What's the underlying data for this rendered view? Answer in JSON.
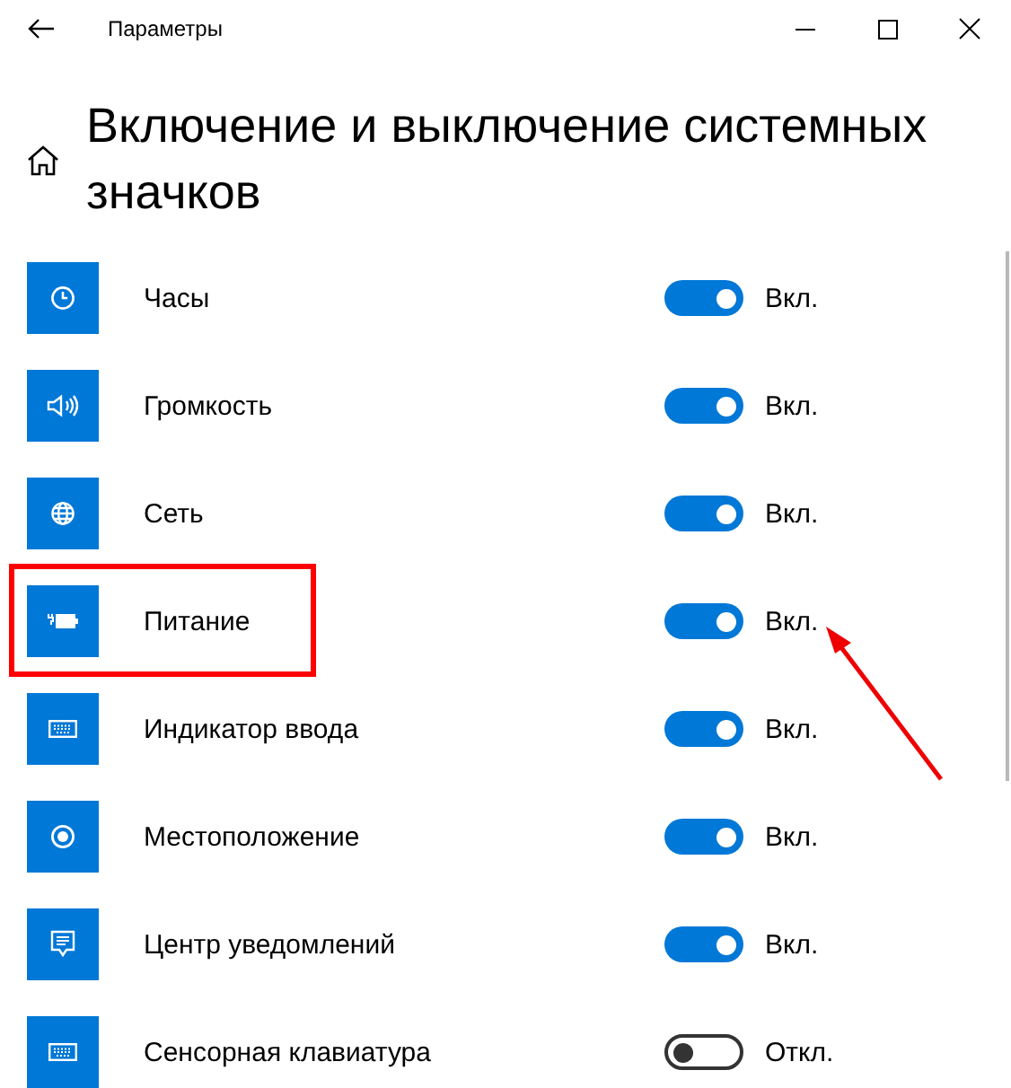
{
  "window": {
    "title": "Параметры"
  },
  "heading": "Включение и выключение системных значков",
  "items": [
    {
      "label": "Часы",
      "on": true,
      "status": "Вкл.",
      "highlighted": false
    },
    {
      "label": "Громкость",
      "on": true,
      "status": "Вкл.",
      "highlighted": false
    },
    {
      "label": "Сеть",
      "on": true,
      "status": "Вкл.",
      "highlighted": false
    },
    {
      "label": "Питание",
      "on": true,
      "status": "Вкл.",
      "highlighted": true
    },
    {
      "label": "Индикатор ввода",
      "on": true,
      "status": "Вкл.",
      "highlighted": false
    },
    {
      "label": "Местоположение",
      "on": true,
      "status": "Вкл.",
      "highlighted": false
    },
    {
      "label": "Центр уведомлений",
      "on": true,
      "status": "Вкл.",
      "highlighted": false
    },
    {
      "label": "Сенсорная клавиатура",
      "on": false,
      "status": "Откл.",
      "highlighted": false
    }
  ]
}
